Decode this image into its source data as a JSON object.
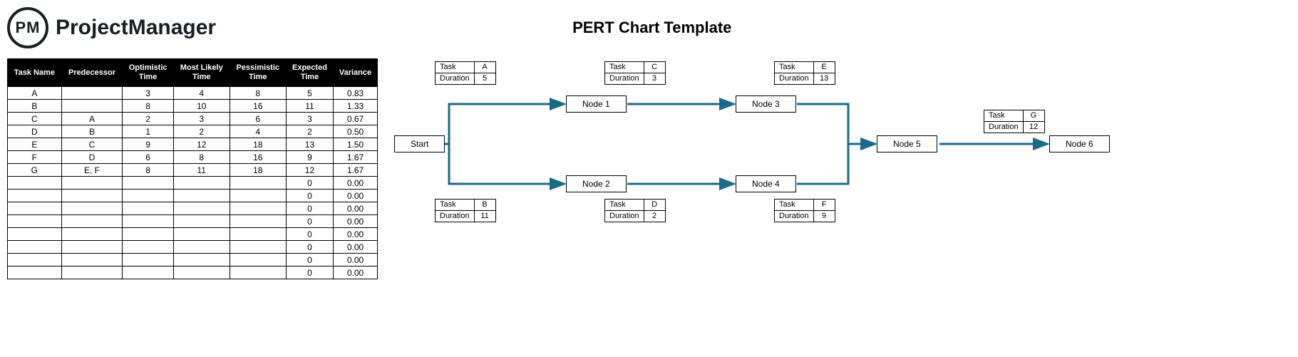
{
  "logo_initials": "PM",
  "logo_text": "ProjectManager",
  "page_title": "PERT Chart Template",
  "table": {
    "headers": [
      "Task Name",
      "Predecessor",
      "Optimistic Time",
      "Most Likely Time",
      "Pessimistic Time",
      "Expected Time",
      "Variance"
    ],
    "rows": [
      {
        "name": "A",
        "pred": "",
        "opt": "3",
        "ml": "4",
        "pess": "8",
        "exp": "5",
        "var": "0.83"
      },
      {
        "name": "B",
        "pred": "",
        "opt": "8",
        "ml": "10",
        "pess": "16",
        "exp": "11",
        "var": "1.33"
      },
      {
        "name": "C",
        "pred": "A",
        "opt": "2",
        "ml": "3",
        "pess": "6",
        "exp": "3",
        "var": "0.67"
      },
      {
        "name": "D",
        "pred": "B",
        "opt": "1",
        "ml": "2",
        "pess": "4",
        "exp": "2",
        "var": "0.50"
      },
      {
        "name": "E",
        "pred": "C",
        "opt": "9",
        "ml": "12",
        "pess": "18",
        "exp": "13",
        "var": "1.50"
      },
      {
        "name": "F",
        "pred": "D",
        "opt": "6",
        "ml": "8",
        "pess": "16",
        "exp": "9",
        "var": "1.67"
      },
      {
        "name": "G",
        "pred": "E, F",
        "opt": "8",
        "ml": "11",
        "pess": "18",
        "exp": "12",
        "var": "1.67"
      },
      {
        "name": "",
        "pred": "",
        "opt": "",
        "ml": "",
        "pess": "",
        "exp": "0",
        "var": "0.00"
      },
      {
        "name": "",
        "pred": "",
        "opt": "",
        "ml": "",
        "pess": "",
        "exp": "0",
        "var": "0.00"
      },
      {
        "name": "",
        "pred": "",
        "opt": "",
        "ml": "",
        "pess": "",
        "exp": "0",
        "var": "0.00"
      },
      {
        "name": "",
        "pred": "",
        "opt": "",
        "ml": "",
        "pess": "",
        "exp": "0",
        "var": "0.00"
      },
      {
        "name": "",
        "pred": "",
        "opt": "",
        "ml": "",
        "pess": "",
        "exp": "0",
        "var": "0.00"
      },
      {
        "name": "",
        "pred": "",
        "opt": "",
        "ml": "",
        "pess": "",
        "exp": "0",
        "var": "0.00"
      },
      {
        "name": "",
        "pred": "",
        "opt": "",
        "ml": "",
        "pess": "",
        "exp": "0",
        "var": "0.00"
      },
      {
        "name": "",
        "pred": "",
        "opt": "",
        "ml": "",
        "pess": "",
        "exp": "0",
        "var": "0.00"
      }
    ]
  },
  "labels": {
    "task": "Task",
    "duration": "Duration",
    "start": "Start"
  },
  "chart": {
    "nodes": {
      "start": "Start",
      "n1": "Node 1",
      "n2": "Node 2",
      "n3": "Node 3",
      "n4": "Node 4",
      "n5": "Node 5",
      "n6": "Node 6"
    },
    "tasks": {
      "A": {
        "task": "A",
        "dur": "5"
      },
      "B": {
        "task": "B",
        "dur": "11"
      },
      "C": {
        "task": "C",
        "dur": "3"
      },
      "D": {
        "task": "D",
        "dur": "2"
      },
      "E": {
        "task": "E",
        "dur": "13"
      },
      "F": {
        "task": "F",
        "dur": "9"
      },
      "G": {
        "task": "G",
        "dur": "12"
      }
    }
  },
  "chart_data": {
    "type": "pert",
    "nodes": [
      "Start",
      "Node 1",
      "Node 2",
      "Node 3",
      "Node 4",
      "Node 5",
      "Node 6"
    ],
    "edges": [
      {
        "from": "Start",
        "to": "Node 1",
        "task": "A",
        "duration": 5
      },
      {
        "from": "Start",
        "to": "Node 2",
        "task": "B",
        "duration": 11
      },
      {
        "from": "Node 1",
        "to": "Node 3",
        "task": "C",
        "duration": 3
      },
      {
        "from": "Node 2",
        "to": "Node 4",
        "task": "D",
        "duration": 2
      },
      {
        "from": "Node 3",
        "to": "Node 5",
        "task": "E",
        "duration": 13
      },
      {
        "from": "Node 4",
        "to": "Node 5",
        "task": "F",
        "duration": 9
      },
      {
        "from": "Node 5",
        "to": "Node 6",
        "task": "G",
        "duration": 12
      }
    ],
    "task_estimates": [
      {
        "name": "A",
        "predecessor": "",
        "optimistic": 3,
        "most_likely": 4,
        "pessimistic": 8,
        "expected": 5,
        "variance": 0.83
      },
      {
        "name": "B",
        "predecessor": "",
        "optimistic": 8,
        "most_likely": 10,
        "pessimistic": 16,
        "expected": 11,
        "variance": 1.33
      },
      {
        "name": "C",
        "predecessor": "A",
        "optimistic": 2,
        "most_likely": 3,
        "pessimistic": 6,
        "expected": 3,
        "variance": 0.67
      },
      {
        "name": "D",
        "predecessor": "B",
        "optimistic": 1,
        "most_likely": 2,
        "pessimistic": 4,
        "expected": 2,
        "variance": 0.5
      },
      {
        "name": "E",
        "predecessor": "C",
        "optimistic": 9,
        "most_likely": 12,
        "pessimistic": 18,
        "expected": 13,
        "variance": 1.5
      },
      {
        "name": "F",
        "predecessor": "D",
        "optimistic": 6,
        "most_likely": 8,
        "pessimistic": 16,
        "expected": 9,
        "variance": 1.67
      },
      {
        "name": "G",
        "predecessor": "E, F",
        "optimistic": 8,
        "most_likely": 11,
        "pessimistic": 18,
        "expected": 12,
        "variance": 1.67
      }
    ]
  }
}
